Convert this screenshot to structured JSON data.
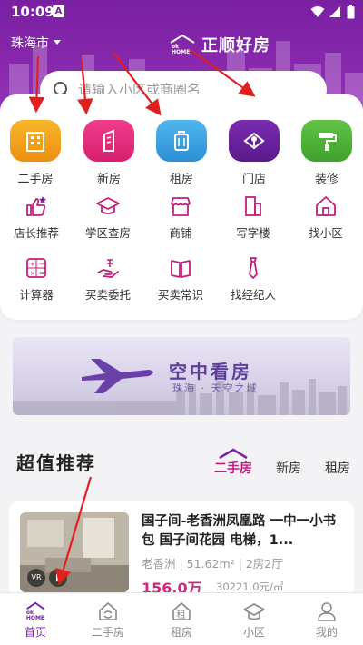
{
  "status_bar": {
    "time": "10:09",
    "notification_icon": "A"
  },
  "header": {
    "city": "珠海市",
    "logo_badge": "ok HOME",
    "logo_text": "正顺好房",
    "search_placeholder": "请输入小区或商圈名"
  },
  "services": {
    "primary": [
      {
        "label": "二手房",
        "icon": "building-icon",
        "color": "#f3a21a"
      },
      {
        "label": "新房",
        "icon": "tower-icon",
        "color": "#e4297d"
      },
      {
        "label": "租房",
        "icon": "luggage-icon",
        "color": "#3aa3e3"
      },
      {
        "label": "门店",
        "icon": "store-icon",
        "color": "#6d23a3"
      },
      {
        "label": "装修",
        "icon": "paint-roller-icon",
        "color": "#52b33a"
      }
    ],
    "secondary": [
      {
        "label": "店长推荐",
        "icon": "thumbs-up-icon"
      },
      {
        "label": "学区查房",
        "icon": "graduation-cap-icon"
      },
      {
        "label": "商铺",
        "icon": "shop-icon"
      },
      {
        "label": "写字楼",
        "icon": "office-building-icon"
      },
      {
        "label": "找小区",
        "icon": "house-icon"
      },
      {
        "label": "计算器",
        "icon": "calculator-icon"
      },
      {
        "label": "买卖委托",
        "icon": "hand-money-icon"
      },
      {
        "label": "买卖常识",
        "icon": "book-icon"
      },
      {
        "label": "找经纪人",
        "icon": "tie-icon"
      }
    ],
    "accent_color": "#c31e7e"
  },
  "banner": {
    "title": "空中看房",
    "subtitle": "珠海 · 天空之城"
  },
  "recommend": {
    "title": "超值推荐",
    "tabs": [
      "二手房",
      "新房",
      "租房"
    ],
    "active_tab": "二手房"
  },
  "listing": {
    "title": "国子间-老香洲凤凰路 一中一小书包 国子间花园 电梯，1...",
    "district": "老香洲",
    "area": "51.62m²",
    "layout": "2房2厅",
    "meta": "老香洲 | 51.62m² | 2房2厅",
    "price": "156.0万",
    "unit_price": "30221.0元/㎡",
    "vr_label": "VR"
  },
  "bottom_nav": [
    {
      "label": "首页",
      "icon": "home-logo-icon",
      "active": true
    },
    {
      "label": "二手房",
      "icon": "secondhand-icon",
      "active": false
    },
    {
      "label": "租房",
      "icon": "rent-icon",
      "active": false
    },
    {
      "label": "小区",
      "icon": "community-icon",
      "active": false
    },
    {
      "label": "我的",
      "icon": "profile-icon",
      "active": false
    }
  ],
  "home_logo_text": "ok HOME",
  "rent_icon_char": "租",
  "brand_color": "#7a1fa2"
}
